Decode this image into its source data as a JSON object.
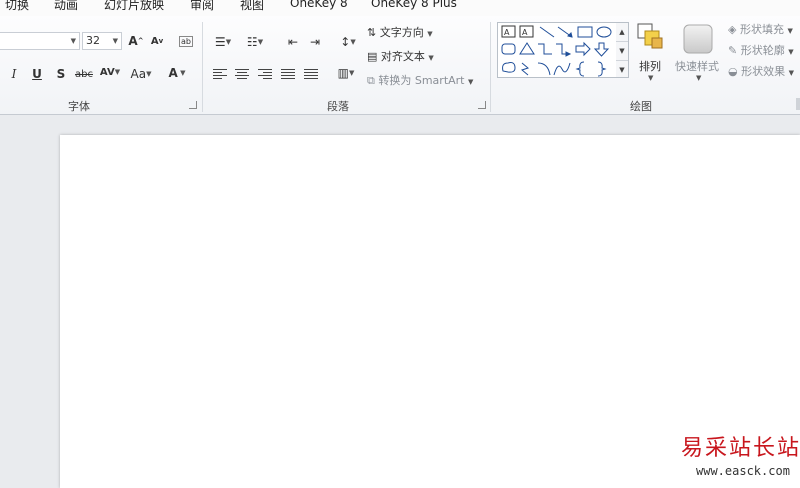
{
  "tabs": [
    "切换",
    "动画",
    "幻灯片放映",
    "审阅",
    "视图",
    "OneKey 8",
    "OneKey 8 Plus"
  ],
  "font_group": {
    "label": "字体",
    "size_value": "32",
    "grow_font": "A",
    "shrink_font": "A",
    "italic": "I",
    "underline": "U",
    "strike": "S",
    "shadow_text": "abc",
    "spacing_text": "AV",
    "case_text": "Aa",
    "color_text": "A"
  },
  "paragraph_group": {
    "label": "段落",
    "text_direction": "文字方向",
    "align_text": "对齐文本",
    "convert_smartart": "转换为 SmartArt"
  },
  "drawing_group": {
    "label": "绘图",
    "arrange": "排列",
    "quick_styles": "快速样式",
    "shape_fill": "形状填充",
    "shape_outline": "形状轮廓",
    "shape_effects": "形状效果"
  },
  "watermark": {
    "title": "易采站长站",
    "url": "www.easck.com"
  },
  "colors": {
    "accent_red": "#c8161d",
    "ribbon_bg": "#f1f3f6",
    "canvas_bg": "#e9ebee"
  }
}
